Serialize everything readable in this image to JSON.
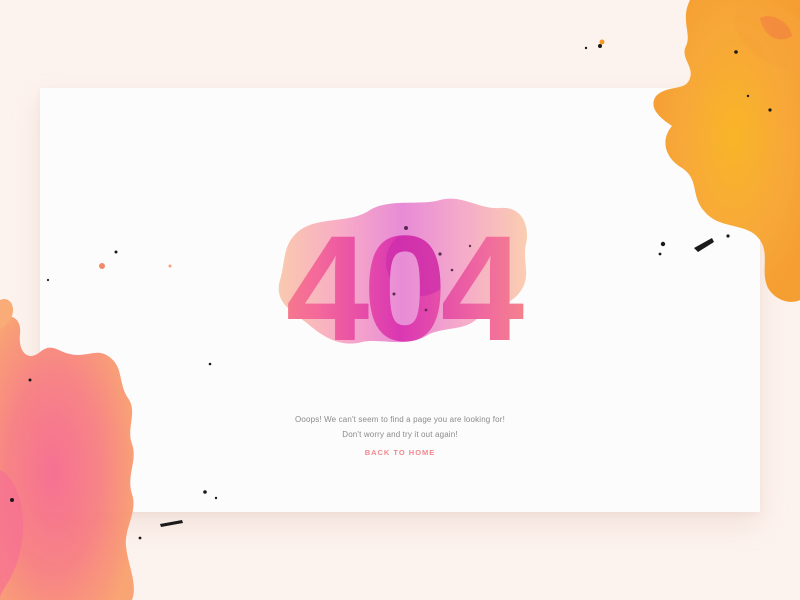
{
  "error": {
    "code": "404",
    "message_line_1": "Ooops! We can't seem to find a page you are looking for!",
    "message_line_2": "Don't worry and try it out again!",
    "back_link_label": "BACK TO HOME"
  },
  "colors": {
    "background": "#fdf3ee",
    "card": "#fcfcfc",
    "accent_link": "#f0888e",
    "text_muted": "#8a8a8a",
    "watercolor_orange": "#f7a532",
    "watercolor_pink": "#f5708a",
    "watercolor_magenta": "#d830b8",
    "watercolor_peach": "#f9a872"
  }
}
